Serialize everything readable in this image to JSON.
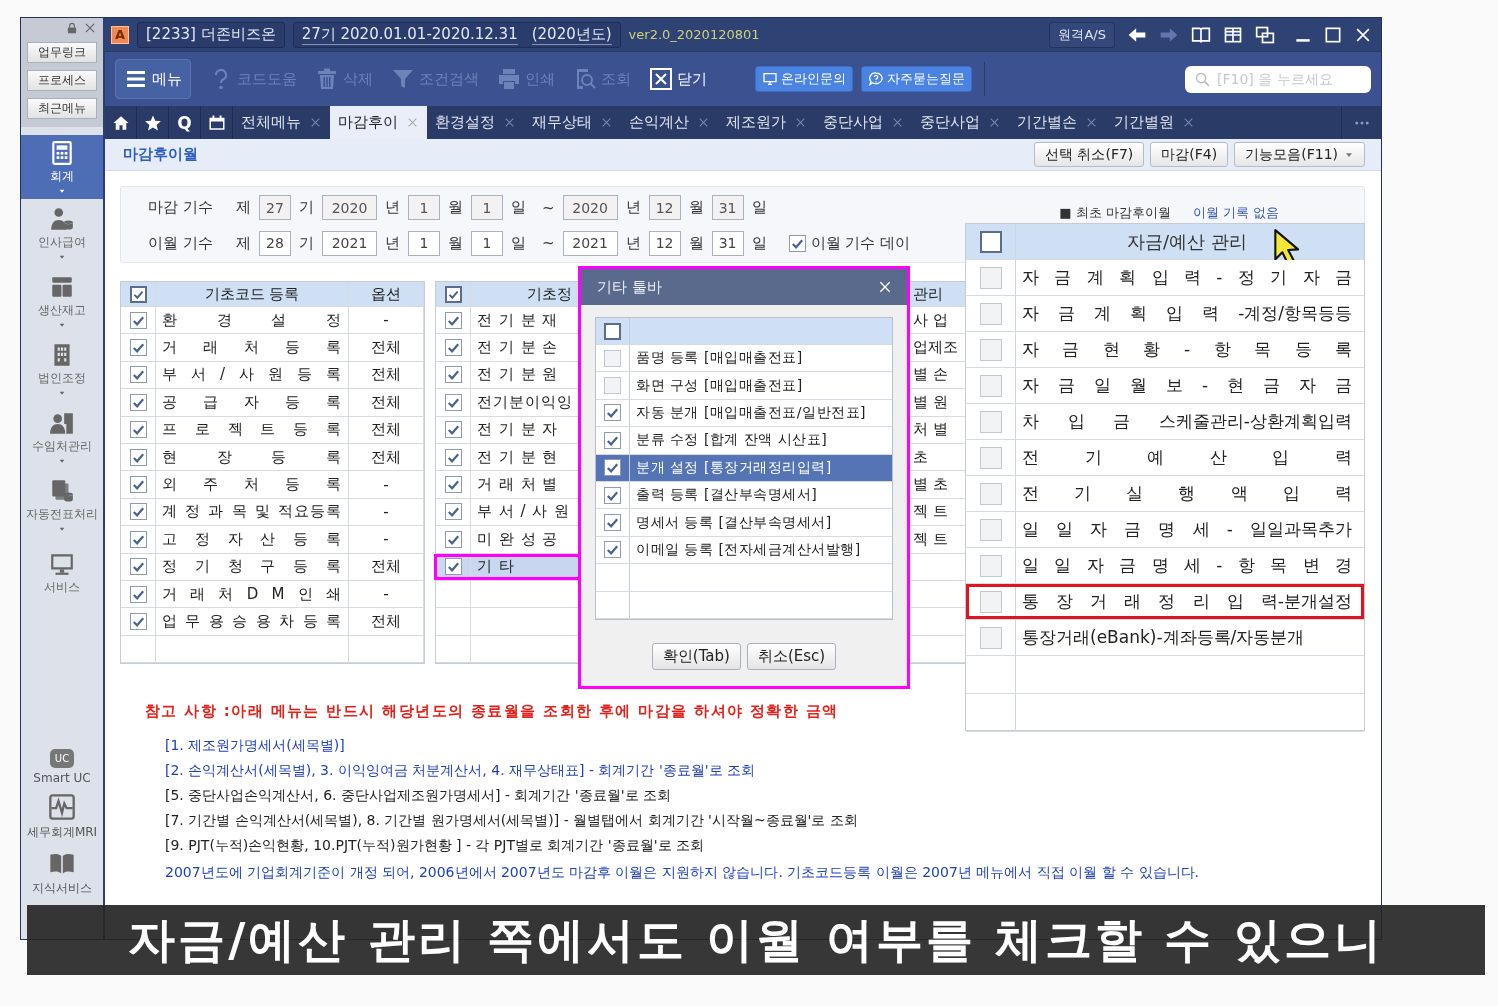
{
  "sidebar": {
    "shortcuts": [
      "업무링크",
      "프로세스",
      "최근메뉴"
    ],
    "modules": [
      {
        "label": "회계",
        "kind": "calculator",
        "selected": true
      },
      {
        "label": "인사급여",
        "kind": "person_db",
        "selected": false
      },
      {
        "label": "생산재고",
        "kind": "blocks",
        "selected": false
      },
      {
        "label": "법인조정",
        "kind": "building",
        "selected": false
      },
      {
        "label": "수임처관리",
        "kind": "people_building",
        "selected": false
      },
      {
        "label": "자동전표처리",
        "kind": "doc_db",
        "selected": false
      },
      {
        "label": "서비스",
        "kind": "monitor",
        "selected": false
      }
    ],
    "services": [
      {
        "label": "Smart UC",
        "kind": "uc",
        "badge": "UC"
      },
      {
        "label": "세무회계MRI",
        "kind": "pulse"
      },
      {
        "label": "지식서비스",
        "kind": "book"
      }
    ]
  },
  "title_bar": {
    "logo": "A",
    "company": "[2233] 더존비즈온",
    "period": "27기  2020.01.01-2020.12.31",
    "year": "(2020년도)",
    "version": "ver2.0_2020120801",
    "remote_button": "원격A/S",
    "nav": [
      {
        "kind": "back",
        "disabled": false
      },
      {
        "kind": "forward",
        "disabled": true
      }
    ],
    "view_icons": [
      {
        "kind": "book"
      },
      {
        "kind": "grid"
      },
      {
        "kind": "windows"
      }
    ]
  },
  "toolbar": {
    "items": [
      {
        "kind": "menu",
        "label": "메뉴",
        "disabled": false
      },
      {
        "kind": "help",
        "label": "코드도움",
        "disabled": true
      },
      {
        "kind": "trash",
        "label": "삭제",
        "disabled": true
      },
      {
        "kind": "filter",
        "label": "조건검색",
        "disabled": true
      },
      {
        "kind": "print",
        "label": "인쇄",
        "disabled": true
      },
      {
        "kind": "lookup",
        "label": "조회",
        "disabled": true
      },
      {
        "kind": "close",
        "label": "닫기",
        "disabled": false
      }
    ],
    "links": [
      {
        "kind": "monitor",
        "label": "온라인문의"
      },
      {
        "kind": "faq",
        "label": "자주묻는질문"
      }
    ],
    "search": {
      "placeholder": "[F10] 을 누르세요"
    }
  },
  "tabs": {
    "quick": [
      {
        "kind": "home"
      },
      {
        "kind": "star"
      },
      {
        "kind": "text",
        "label": "Q"
      },
      {
        "kind": "calendar"
      }
    ],
    "items": [
      {
        "label": "전체메뉴",
        "selected": false
      },
      {
        "label": "마감후이",
        "selected": true
      },
      {
        "label": "환경설정",
        "selected": false
      },
      {
        "label": "재무상태",
        "selected": false
      },
      {
        "label": "손익계산",
        "selected": false
      },
      {
        "label": "제조원가",
        "selected": false
      },
      {
        "label": "중단사업",
        "selected": false
      },
      {
        "label": "중단사업",
        "selected": false
      },
      {
        "label": "기간별손",
        "selected": false
      },
      {
        "label": "기간별원",
        "selected": false
      }
    ]
  },
  "page": {
    "title": "마감후이월",
    "buttons": [
      {
        "label": "선택 취소(F7)",
        "dropdown": false
      },
      {
        "label": "마감(F4)",
        "dropdown": false
      },
      {
        "label": "기능모음(F11)",
        "dropdown": true
      }
    ]
  },
  "period_form": {
    "rows": [
      {
        "label": "마감 기수",
        "parts": [
          {
            "kind": "text",
            "text": "제"
          },
          {
            "kind": "field",
            "value": "27",
            "disabled": true
          },
          {
            "kind": "text",
            "text": "기"
          },
          {
            "kind": "field",
            "value": "2020",
            "disabled": true
          },
          {
            "kind": "text",
            "text": "년"
          },
          {
            "kind": "field",
            "value": "1",
            "disabled": true
          },
          {
            "kind": "text",
            "text": "월"
          },
          {
            "kind": "field",
            "value": "1",
            "disabled": true
          },
          {
            "kind": "text",
            "text": "일"
          },
          {
            "kind": "text",
            "text": "~"
          },
          {
            "kind": "field",
            "value": "2020",
            "disabled": true
          },
          {
            "kind": "text",
            "text": "년"
          },
          {
            "kind": "field",
            "value": "12",
            "disabled": true
          },
          {
            "kind": "text",
            "text": "월"
          },
          {
            "kind": "field",
            "value": "31",
            "disabled": true
          },
          {
            "kind": "text",
            "text": "일"
          }
        ]
      },
      {
        "label": "이월 기수",
        "parts": [
          {
            "kind": "text",
            "text": "제"
          },
          {
            "kind": "field",
            "value": "28",
            "disabled": false
          },
          {
            "kind": "text",
            "text": "기"
          },
          {
            "kind": "field",
            "value": "2021",
            "disabled": false
          },
          {
            "kind": "text",
            "text": "년"
          },
          {
            "kind": "field",
            "value": "1",
            "disabled": false
          },
          {
            "kind": "text",
            "text": "월"
          },
          {
            "kind": "field",
            "value": "1",
            "disabled": false
          },
          {
            "kind": "text",
            "text": "일"
          },
          {
            "kind": "text",
            "text": "~"
          },
          {
            "kind": "field",
            "value": "2021",
            "disabled": false
          },
          {
            "kind": "text",
            "text": "년"
          },
          {
            "kind": "field",
            "value": "12",
            "disabled": false
          },
          {
            "kind": "text",
            "text": "월"
          },
          {
            "kind": "field",
            "value": "31",
            "disabled": false
          },
          {
            "kind": "text",
            "text": "일"
          },
          {
            "kind": "checkbox",
            "label": "이월 기수 데이",
            "checked": true
          }
        ]
      }
    ],
    "first_carryover": {
      "label": "■ 최초 마감후이월",
      "value": "이월 기록 없음"
    }
  },
  "code_grid": {
    "all_checked": true,
    "columns": [
      "기초코드 등록",
      "옵션"
    ],
    "rows": [
      {
        "name": "환 경 설 정",
        "option": "-",
        "checked": true
      },
      {
        "name": "거 래 처 등 록",
        "option": "전체",
        "checked": true
      },
      {
        "name": "부 서 / 사 원 등 록",
        "option": "전체",
        "checked": true
      },
      {
        "name": "공 급 자 등 록",
        "option": "전체",
        "checked": true
      },
      {
        "name": "프 로 젝 트 등 록",
        "option": "전체",
        "checked": true
      },
      {
        "name": "현 장 등 록",
        "option": "전체",
        "checked": true
      },
      {
        "name": "외 주 처 등 록",
        "option": "-",
        "checked": true
      },
      {
        "name": "계 정 과 목 및 적요등록",
        "option": "-",
        "checked": true
      },
      {
        "name": "고 정 자 산 등 록",
        "option": "-",
        "checked": true
      },
      {
        "name": "정 기 청 구 등 록",
        "option": "전체",
        "checked": true
      },
      {
        "name": "거 래 처 D M 인 쇄",
        "option": "-",
        "checked": true
      },
      {
        "name": "업 무 용 승 용 차 등 록",
        "option": "전체",
        "checked": true
      }
    ]
  },
  "info_grid": {
    "all_checked": true,
    "column": "기초정",
    "rows": [
      {
        "name": "전 기 분 재",
        "checked": true,
        "selected": false,
        "highlighted": false
      },
      {
        "name": "전 기 분 손",
        "checked": true,
        "selected": false,
        "highlighted": false
      },
      {
        "name": "전 기 분 원",
        "checked": true,
        "selected": false,
        "highlighted": false
      },
      {
        "name": "전기분이익잉",
        "checked": true,
        "selected": false,
        "highlighted": false
      },
      {
        "name": "전 기 분 자",
        "checked": true,
        "selected": false,
        "highlighted": false
      },
      {
        "name": "전 기 분 현",
        "checked": true,
        "selected": false,
        "highlighted": false
      },
      {
        "name": "거 래 처 별",
        "checked": true,
        "selected": false,
        "highlighted": false
      },
      {
        "name": "부 서 / 사 원",
        "checked": true,
        "selected": false,
        "highlighted": false
      },
      {
        "name": "미 완 성 공",
        "checked": true,
        "selected": false,
        "highlighted": false
      },
      {
        "name": "기 타",
        "checked": true,
        "selected": true,
        "highlighted": true
      }
    ]
  },
  "management_grid": {
    "column": "관리",
    "rows": [
      "사 업",
      "업제조",
      "별 손",
      "별 원",
      "처 별",
      "초",
      "별 초",
      "젝 트",
      "젝 트"
    ]
  },
  "dialog": {
    "title": "기타 툴바",
    "highlighted": true,
    "all_checked": false,
    "items": [
      {
        "label": "품명 등록 [매입매출전표]",
        "checked": false,
        "selected": false
      },
      {
        "label": "화면 구성 [매입매출전표]",
        "checked": false,
        "selected": false
      },
      {
        "label": "자동 분개 [매입매출전표/일반전표]",
        "checked": true,
        "selected": false
      },
      {
        "label": "분류 수정 [합계 잔액 시산표]",
        "checked": true,
        "selected": false
      },
      {
        "label": "분개 설정 [통장거래정리입력]",
        "checked": true,
        "selected": true
      },
      {
        "label": "출력 등록 [결산부속명세서]",
        "checked": true,
        "selected": false
      },
      {
        "label": "명세서 등록 [결산부속명세서]",
        "checked": true,
        "selected": false
      },
      {
        "label": "이메일 등록 [전자세금계산서발행]",
        "checked": true,
        "selected": false
      }
    ],
    "buttons": [
      "확인(Tab)",
      "취소(Esc)"
    ]
  },
  "fund_panel": {
    "title": "자금/예산 관리",
    "all_checked": false,
    "rows": [
      {
        "name": "자 금 계 획 입 력 - 정 기 자 금",
        "checked": false,
        "highlighted": false
      },
      {
        "name": "자 금 계 획 입 력 -계정/항목등등",
        "checked": false,
        "highlighted": false
      },
      {
        "name": "자 금 현 황 - 항 목 등 록",
        "checked": false,
        "highlighted": false
      },
      {
        "name": "자 금 일 월 보 - 현 금 자 금",
        "checked": false,
        "highlighted": false
      },
      {
        "name": "차 입 금 스케줄관리-상환계획입력",
        "checked": false,
        "highlighted": false
      },
      {
        "name": "전 기 예 산 입 력",
        "checked": false,
        "highlighted": false
      },
      {
        "name": "전 기 실 행 액 입 력",
        "checked": false,
        "highlighted": false
      },
      {
        "name": "일 일 자 금 명 세 - 일일과목추가",
        "checked": false,
        "highlighted": false
      },
      {
        "name": "일 일 자 금 명 세 - 항 목 변 경",
        "checked": false,
        "highlighted": false
      },
      {
        "name": "통 장 거 래 정 리 입 력-분개설정",
        "checked": false,
        "highlighted": true
      },
      {
        "name": "통장거래(eBank)-계좌등록/자동분개",
        "checked": false,
        "highlighted": false
      }
    ]
  },
  "notes": {
    "warning": "참고 사항 :아래 메뉴는 반드시 해당년도의 종료월을 조회한 후에 마감을 하셔야 정확한 금액",
    "lines": [
      {
        "text": "[1. 제조원가명세서(세목별)]",
        "color": "#1f3fb8"
      },
      {
        "text": "[2. 손익계산서(세목별), 3. 이익잉여금 처분계산서, 4. 재무상태표] - 회계기간 '종료월'로 조회",
        "color": "#1f3fb8"
      },
      {
        "text": "[5. 중단사업손익계산서, 6. 중단사업제조원가명세서] - 회계기간 '종료월'로 조회",
        "color": "#222222"
      },
      {
        "text": "[7. 기간별 손익계산서(세목별), 8. 기간별 원가명세서(세목별)] - 월별탭에서 회계기간 '시작월~종료월'로 조회",
        "color": "#222222"
      },
      {
        "text": "[9. PJT(누적)손익현황, 10.PJT(누적)원가현황 ] - 각 PJT별로 회계기간 '종료월'로 조회",
        "color": "#222222"
      },
      {
        "text": "2007년도에 기업회계기준이 개정 되어, 2006년에서 2007년도 마감후 이월은 지원하지 않습니다. 기초코드등록 이월은 2007년 메뉴에서 직접 이월 할 수 있습니다.",
        "color": "#1f3fb8"
      }
    ]
  },
  "subtitle": "자금/예산 관리 쪽에서도 이월 여부를 체크할 수 있으니"
}
